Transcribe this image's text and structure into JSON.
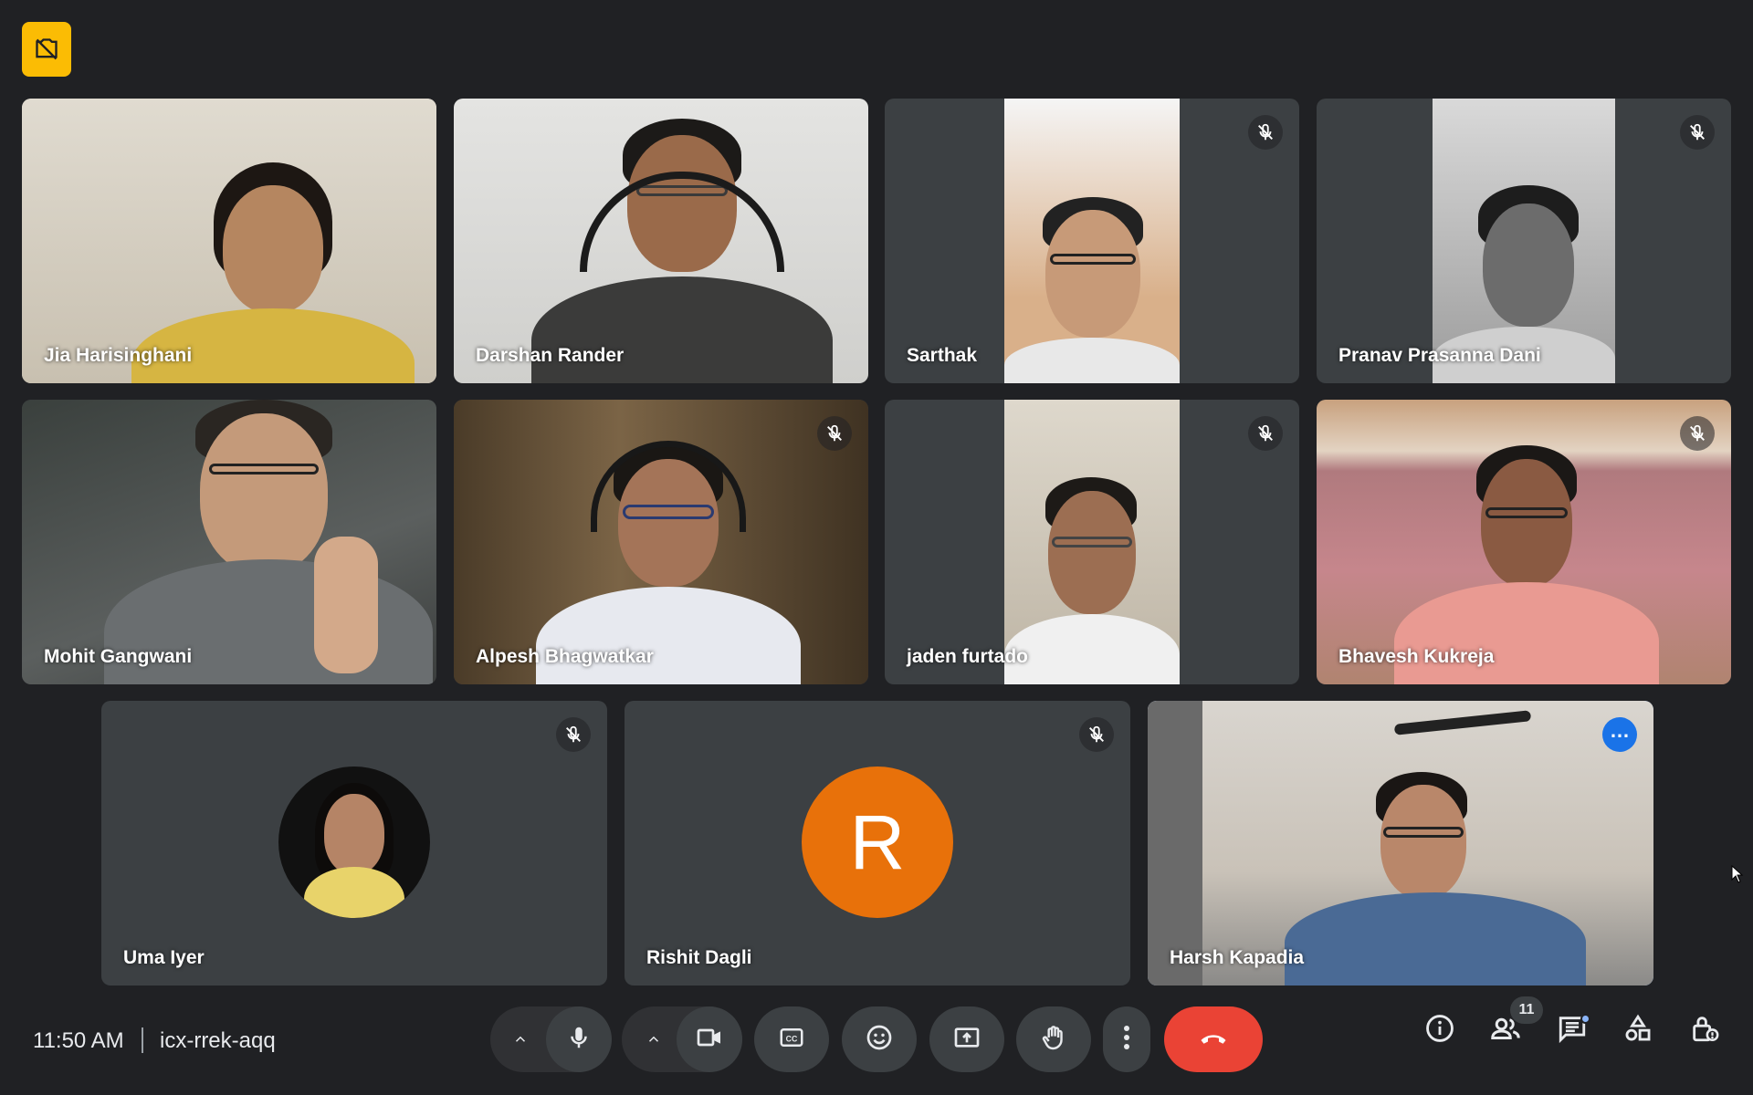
{
  "meeting": {
    "time": "11:50 AM",
    "code": "icx-rrek-aqq",
    "participant_count": "11"
  },
  "participants": [
    {
      "name": "Jia Harisinghani",
      "muted": false
    },
    {
      "name": "Darshan Rander",
      "muted": false
    },
    {
      "name": "Sarthak",
      "muted": true
    },
    {
      "name": "Pranav Prasanna Dani",
      "muted": true
    },
    {
      "name": "Mohit Gangwani",
      "muted": false
    },
    {
      "name": "Alpesh Bhagwatkar",
      "muted": true
    },
    {
      "name": "jaden furtado",
      "muted": true
    },
    {
      "name": "Bhavesh Kukreja",
      "muted": true
    },
    {
      "name": "Uma Iyer",
      "muted": true
    },
    {
      "name": "Rishit Dagli",
      "muted": true,
      "avatar_letter": "R"
    },
    {
      "name": "Harsh Kapadia",
      "muted": false,
      "selected": true
    }
  ],
  "icons": {
    "recording": "no-video-recording-icon",
    "mic": "microphone-icon",
    "camera": "video-camera-icon",
    "captions": "closed-captions-icon",
    "emoji": "emoji-icon",
    "present": "present-screen-icon",
    "hand": "raise-hand-icon",
    "more": "more-vertical-icon",
    "end": "end-call-icon",
    "info": "info-icon",
    "people": "people-icon",
    "chat": "chat-icon",
    "activities": "activities-icon",
    "host": "host-controls-icon"
  },
  "colors": {
    "background": "#202124",
    "tile": "#3c4043",
    "end_call": "#ea4335",
    "recording_badge": "#fbbc04",
    "selected_outline": "#8ab4f8",
    "avatar_R": "#e8710a"
  }
}
